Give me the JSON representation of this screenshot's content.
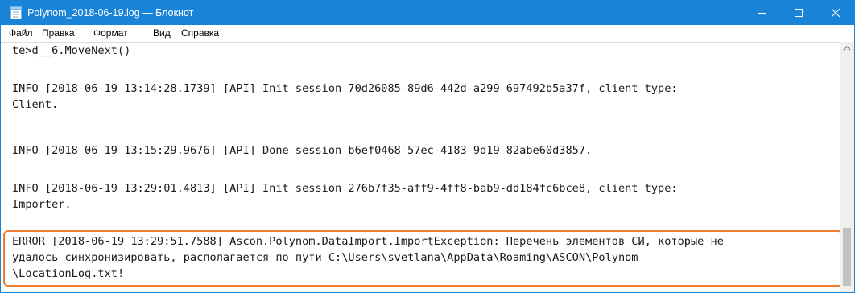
{
  "window": {
    "title": "Polynom_2018-06-19.log — Блокнот",
    "minimize_icon": "minimize-icon",
    "maximize_icon": "maximize-icon",
    "close_icon": "close-icon",
    "app_icon": "notepad-icon",
    "accent_color": "#1883d7"
  },
  "menu": {
    "items": [
      "Файл",
      "Правка",
      "Формат",
      "Вид",
      "Справка"
    ]
  },
  "editor": {
    "lines": [
      "te>d__6.MoveNext()",
      "",
      "INFO [2018-06-19 13:14:28.1739] [API] Init session 70d26085-89d6-442d-a299-697492b5a37f, client type:",
      "Client.",
      "",
      "INFO [2018-06-19 13:15:29.9676] [API] Done session b6ef0468-57ec-4183-9d19-82abe60d3857.",
      "",
      "INFO [2018-06-19 13:29:01.4813] [API] Init session 276b7f35-aff9-4ff8-bab9-dd184fc6bce8, client type:",
      "Importer.",
      "",
      "ERROR [2018-06-19 13:29:51.7588] Ascon.Polynom.DataImport.ImportException: Перечень элементов СИ, которые не",
      "удалось синхронизировать, располагается по пути C:\\Users\\svetlana\\AppData\\Roaming\\ASCON\\Polynom",
      "\\LocationLog.txt!"
    ],
    "highlight_color": "#ed7d31"
  },
  "scrollbar": {
    "up_icon": "scroll-up-arrow-icon"
  }
}
